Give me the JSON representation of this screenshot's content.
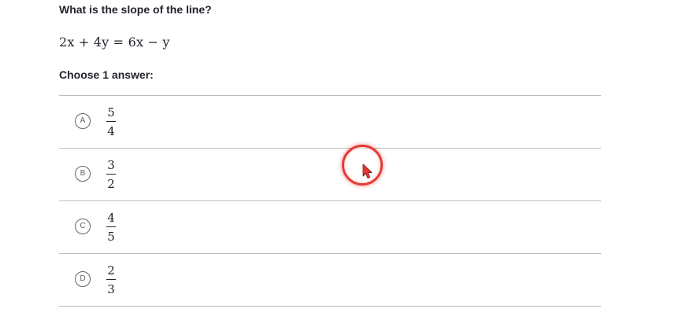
{
  "question": {
    "title": "What is the slope of the line?",
    "equation": "2x + 4y = 6x − y",
    "prompt": "Choose 1 answer:"
  },
  "choices": [
    {
      "letter": "A",
      "numerator": "5",
      "denominator": "4"
    },
    {
      "letter": "B",
      "numerator": "3",
      "denominator": "2"
    },
    {
      "letter": "C",
      "numerator": "4",
      "denominator": "5"
    },
    {
      "letter": "D",
      "numerator": "2",
      "denominator": "3"
    }
  ],
  "cursor": {
    "highlight_color": "#e53935"
  }
}
